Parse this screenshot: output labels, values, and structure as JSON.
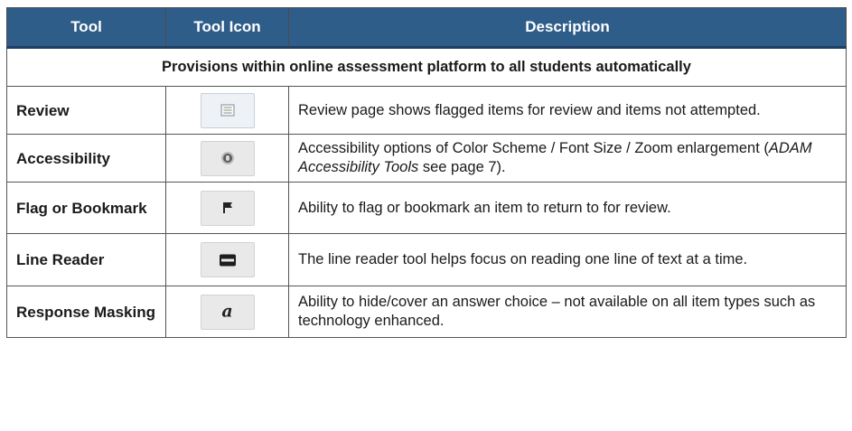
{
  "table": {
    "headers": [
      "Tool",
      "Tool Icon",
      "Description"
    ],
    "section_title": "Provisions within online assessment platform to all students automatically",
    "rows": [
      {
        "tool": "Review",
        "icon": "review-icon",
        "desc_pre": "Review page shows flagged items for review and items not attempted.",
        "desc_em": "",
        "desc_post": ""
      },
      {
        "tool": "Accessibility",
        "icon": "accessibility-icon",
        "desc_pre": "Accessibility options of Color Scheme / Font Size / Zoom enlargement (",
        "desc_em": "ADAM Accessibility Tools",
        "desc_post": " see page 7)."
      },
      {
        "tool": "Flag or Bookmark",
        "icon": "flag-icon",
        "desc_pre": "Ability to flag or bookmark an item to return to for review.",
        "desc_em": "",
        "desc_post": ""
      },
      {
        "tool": "Line Reader",
        "icon": "line-reader-icon",
        "desc_pre": "The line reader tool helps focus on reading one line of text at a time.",
        "desc_em": "",
        "desc_post": ""
      },
      {
        "tool": "Response Masking",
        "icon": "response-masking-icon",
        "icon_text": "a",
        "desc_pre": "Ability to hide/cover an answer choice – not available on all item types such as technology enhanced.",
        "desc_em": "",
        "desc_post": ""
      }
    ],
    "colors": {
      "header_bg": "#2f5d8a",
      "header_text": "#ffffff",
      "border": "#555555"
    }
  }
}
